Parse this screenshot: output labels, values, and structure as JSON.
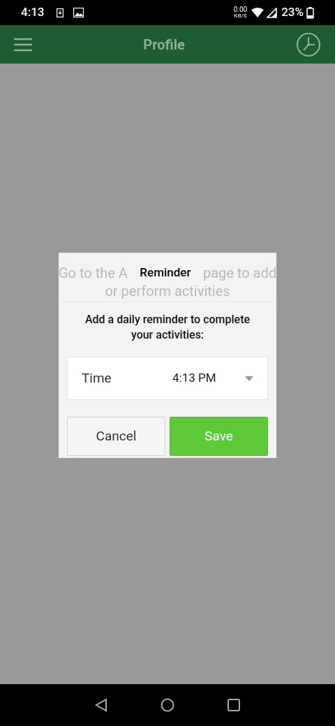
{
  "status_bar": {
    "time": "4:13",
    "speed": "0.00",
    "speed_unit": "KB/S",
    "battery": "23%"
  },
  "app_bar": {
    "title": "Profile"
  },
  "background_message": {
    "line_1_left": "Go to the A",
    "line_1_right": "page to add",
    "line_2": "or perform activities"
  },
  "dialog": {
    "title": "Reminder",
    "message": "Add a daily reminder to complete your activities:",
    "time_field": {
      "label": "Time",
      "value": "4:13 PM"
    },
    "buttons": [
      {
        "label": "Cancel",
        "kind": "secondary"
      },
      {
        "label": "Save",
        "kind": "primary"
      }
    ]
  }
}
